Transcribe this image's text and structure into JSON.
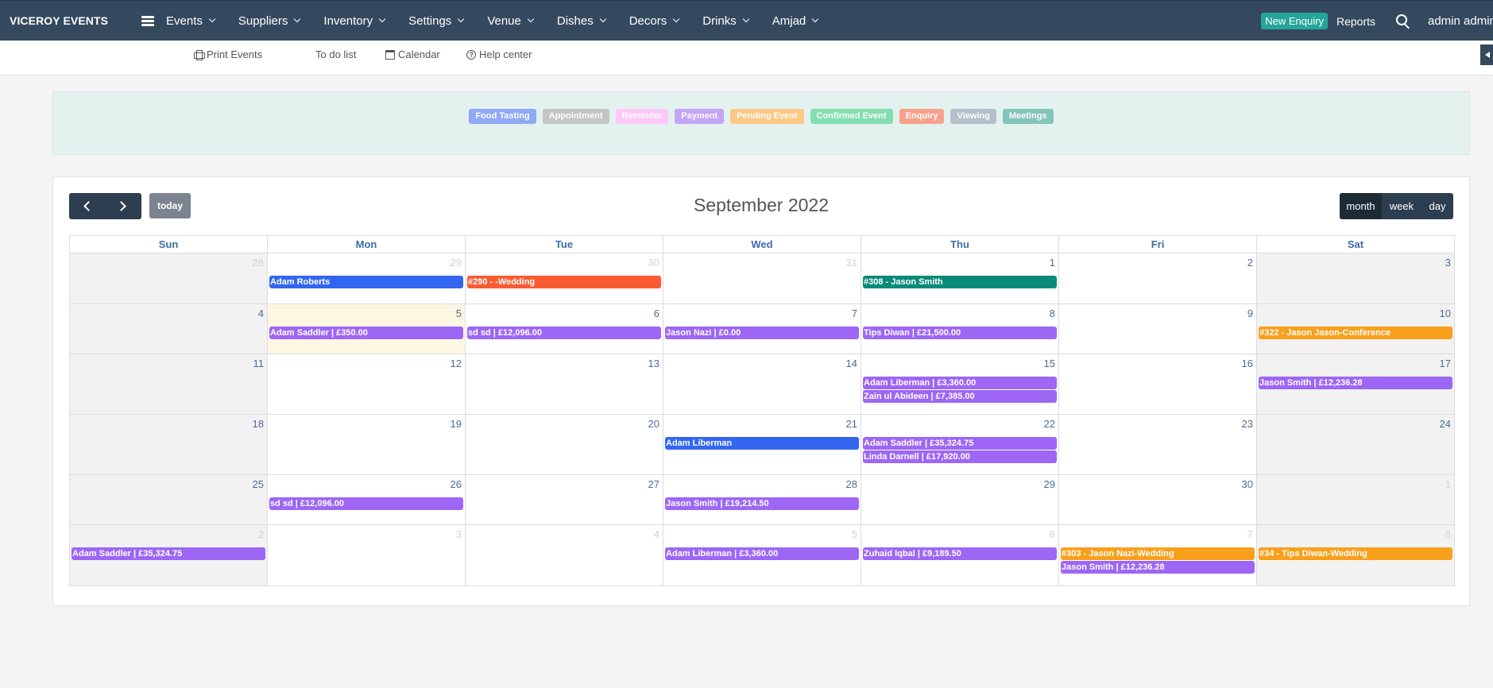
{
  "navbar": {
    "brand": "VICEROY EVENTS",
    "menu": [
      {
        "label": "Events"
      },
      {
        "label": "Suppliers"
      },
      {
        "label": "Inventory"
      },
      {
        "label": "Settings"
      },
      {
        "label": "Venue"
      },
      {
        "label": "Dishes"
      },
      {
        "label": "Decors"
      },
      {
        "label": "Drinks"
      },
      {
        "label": "Amjad"
      }
    ],
    "new_enquiry": "New Enquiry",
    "reports": "Reports",
    "search_icon": "search-icon",
    "user": "admin admin"
  },
  "subbar": {
    "print_events": "Print Events",
    "todo_list": "To do list",
    "calendar": "Calendar",
    "help_center": "Help center"
  },
  "legend": [
    {
      "label": "Food Tasting",
      "color": "#8fa9f5"
    },
    {
      "label": "Appointment",
      "color": "#c5c5c5"
    },
    {
      "label": "Reminder",
      "color": "#fcc9f7"
    },
    {
      "label": "Payment",
      "color": "#c3a4f5"
    },
    {
      "label": "Pending Event",
      "color": "#fcc884"
    },
    {
      "label": "Confirmed Event",
      "color": "#83dfb2"
    },
    {
      "label": "Enquiry",
      "color": "#f7a08b"
    },
    {
      "label": "Viewing",
      "color": "#b4bfc9"
    },
    {
      "label": "Meetings",
      "color": "#84c5bb"
    }
  ],
  "calendar": {
    "title": "September 2022",
    "today_label": "today",
    "views": [
      {
        "label": "month",
        "active": true
      },
      {
        "label": "week",
        "active": false
      },
      {
        "label": "day",
        "active": false
      }
    ],
    "weekdays": [
      "Sun",
      "Mon",
      "Tue",
      "Wed",
      "Thu",
      "Fri",
      "Sat"
    ],
    "colors": {
      "blue": "#3366f0",
      "red": "#fa5b32",
      "teal": "#0a8a78",
      "purple": "#9d66f5",
      "orange": "#f8a01c"
    },
    "weeks": [
      [
        {
          "day": "28",
          "other": true,
          "events": []
        },
        {
          "day": "29",
          "other": true,
          "events": [
            {
              "title": "Adam Roberts",
              "color": "blue"
            }
          ]
        },
        {
          "day": "30",
          "other": true,
          "events": [
            {
              "title": "#290 - -Wedding",
              "color": "red"
            }
          ]
        },
        {
          "day": "31",
          "other": true,
          "events": []
        },
        {
          "day": "1",
          "events": [
            {
              "title": "#308 - Jason Smith",
              "color": "teal"
            }
          ]
        },
        {
          "day": "2",
          "events": []
        },
        {
          "day": "3",
          "events": []
        }
      ],
      [
        {
          "day": "4",
          "events": []
        },
        {
          "day": "5",
          "today": true,
          "events": [
            {
              "title": "Adam Saddler | £350.00",
              "color": "purple"
            }
          ]
        },
        {
          "day": "6",
          "events": [
            {
              "title": "sd sd | £12,096.00",
              "color": "purple"
            }
          ]
        },
        {
          "day": "7",
          "events": [
            {
              "title": "Jason Nazi | £0.00",
              "color": "purple"
            }
          ]
        },
        {
          "day": "8",
          "events": [
            {
              "title": "Tips Diwan | £21,500.00",
              "color": "purple"
            }
          ]
        },
        {
          "day": "9",
          "events": []
        },
        {
          "day": "10",
          "events": [
            {
              "title": "#322 - Jason Jason-Conference",
              "color": "orange"
            }
          ]
        }
      ],
      [
        {
          "day": "11",
          "events": []
        },
        {
          "day": "12",
          "events": []
        },
        {
          "day": "13",
          "events": []
        },
        {
          "day": "14",
          "events": []
        },
        {
          "day": "15",
          "events": [
            {
              "title": "Adam Liberman | £3,360.00",
              "color": "purple"
            },
            {
              "title": "Zain ul Abideen | £7,385.00",
              "color": "purple"
            }
          ]
        },
        {
          "day": "16",
          "events": []
        },
        {
          "day": "17",
          "events": [
            {
              "title": "Jason Smith | £12,236.28",
              "color": "purple"
            }
          ]
        }
      ],
      [
        {
          "day": "18",
          "events": []
        },
        {
          "day": "19",
          "events": []
        },
        {
          "day": "20",
          "events": []
        },
        {
          "day": "21",
          "events": [
            {
              "title": "Adam Liberman",
              "color": "blue"
            }
          ]
        },
        {
          "day": "22",
          "events": [
            {
              "title": "Adam Saddler | £35,324.75",
              "color": "purple"
            },
            {
              "title": "Linda Darnell | £17,920.00",
              "color": "purple"
            }
          ]
        },
        {
          "day": "23",
          "events": []
        },
        {
          "day": "24",
          "events": []
        }
      ],
      [
        {
          "day": "25",
          "events": []
        },
        {
          "day": "26",
          "events": [
            {
              "title": "sd sd | £12,096.00",
              "color": "purple"
            }
          ]
        },
        {
          "day": "27",
          "events": []
        },
        {
          "day": "28",
          "events": [
            {
              "title": "Jason Smith | £19,214.50",
              "color": "purple"
            }
          ]
        },
        {
          "day": "29",
          "events": []
        },
        {
          "day": "30",
          "events": []
        },
        {
          "day": "1",
          "other": true,
          "events": []
        }
      ],
      [
        {
          "day": "2",
          "other": true,
          "events": [
            {
              "title": "Adam Saddler | £35,324.75",
              "color": "purple"
            }
          ]
        },
        {
          "day": "3",
          "other": true,
          "events": []
        },
        {
          "day": "4",
          "other": true,
          "events": []
        },
        {
          "day": "5",
          "other": true,
          "events": [
            {
              "title": "Adam Liberman | £3,360.00",
              "color": "purple"
            }
          ]
        },
        {
          "day": "6",
          "other": true,
          "events": [
            {
              "title": "Zuhaid Iqbal | £9,189.50",
              "color": "purple"
            }
          ]
        },
        {
          "day": "7",
          "other": true,
          "events": [
            {
              "title": "#303 - Jason Nazi-Wedding",
              "color": "orange"
            },
            {
              "title": "Jason Smith | £12,236.28",
              "color": "purple"
            }
          ]
        },
        {
          "day": "8",
          "other": true,
          "events": [
            {
              "title": "#34 - Tips Diwan-Wedding",
              "color": "orange"
            }
          ]
        }
      ]
    ]
  }
}
